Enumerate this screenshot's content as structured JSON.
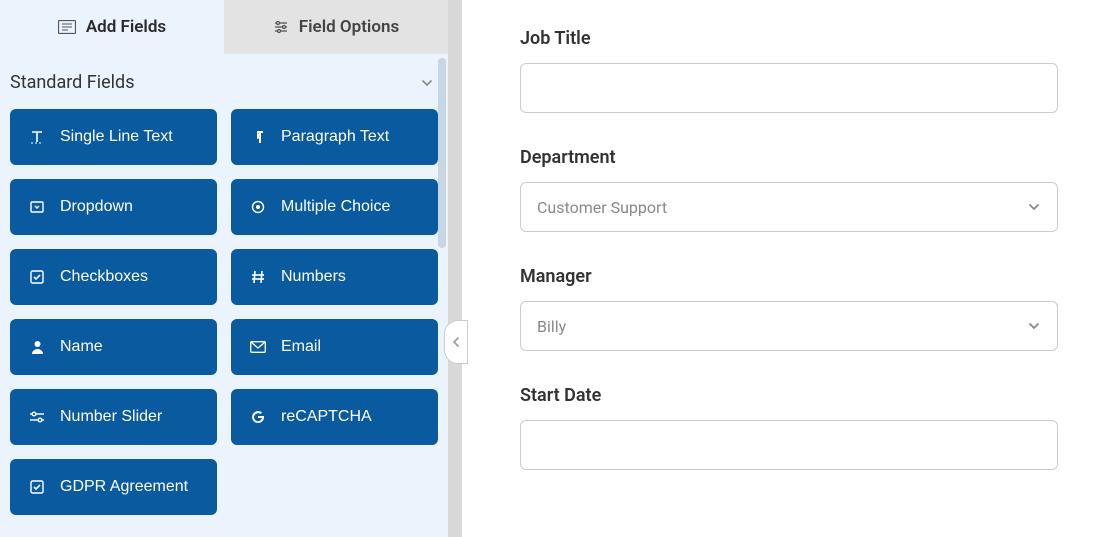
{
  "sidebar": {
    "tabs": {
      "add_fields": "Add Fields",
      "field_options": "Field Options"
    },
    "section_title": "Standard Fields",
    "fields": [
      {
        "label": "Single Line Text",
        "icon": "text-icon"
      },
      {
        "label": "Paragraph Text",
        "icon": "paragraph-icon"
      },
      {
        "label": "Dropdown",
        "icon": "dropdown-icon"
      },
      {
        "label": "Multiple Choice",
        "icon": "radio-icon"
      },
      {
        "label": "Checkboxes",
        "icon": "checkbox-icon"
      },
      {
        "label": "Numbers",
        "icon": "hash-icon"
      },
      {
        "label": "Name",
        "icon": "person-icon"
      },
      {
        "label": "Email",
        "icon": "envelope-icon"
      },
      {
        "label": "Number Slider",
        "icon": "slider-icon"
      },
      {
        "label": "reCAPTCHA",
        "icon": "google-icon"
      },
      {
        "label": "GDPR Agreement",
        "icon": "checksquare-icon"
      }
    ]
  },
  "form": {
    "fields": [
      {
        "label": "Job Title",
        "type": "text",
        "value": ""
      },
      {
        "label": "Department",
        "type": "select",
        "value": "Customer Support"
      },
      {
        "label": "Manager",
        "type": "select",
        "value": "Billy"
      },
      {
        "label": "Start Date",
        "type": "text",
        "value": ""
      }
    ]
  }
}
